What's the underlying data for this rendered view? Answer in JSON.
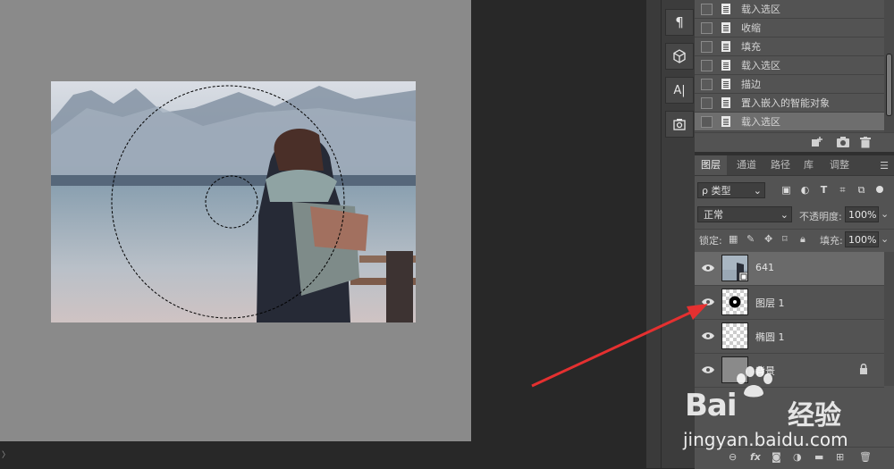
{
  "history": {
    "items": [
      {
        "label": "载入选区",
        "active": false
      },
      {
        "label": "收缩",
        "active": false
      },
      {
        "label": "填充",
        "active": false
      },
      {
        "label": "载入选区",
        "active": false
      },
      {
        "label": "描边",
        "active": false
      },
      {
        "label": "置入嵌入的智能对象",
        "active": false
      },
      {
        "label": "载入选区",
        "active": true
      }
    ]
  },
  "tools": {
    "paragraph": "¶",
    "box3d": "⬡",
    "char": "A|",
    "clone": "⊕"
  },
  "layers": {
    "tabs": [
      "图层",
      "通道",
      "路径",
      "库",
      "调整"
    ],
    "filter_label": "ρ 类型",
    "blend_mode": "正常",
    "opacity_label": "不透明度:",
    "opacity_value": "100%",
    "lock_label": "锁定:",
    "fill_label": "填充:",
    "fill_value": "100%",
    "items": [
      {
        "name": "641",
        "selected": true
      },
      {
        "name": "图层 1",
        "selected": false
      },
      {
        "name": "椭圆 1",
        "selected": false
      },
      {
        "name": "背景",
        "selected": false
      }
    ]
  },
  "watermark": {
    "logo": "Bai",
    "logo_cn": "经验",
    "url": "jingyan.baidu.com"
  },
  "colors": {
    "annotation_arrow": "#e53030"
  }
}
